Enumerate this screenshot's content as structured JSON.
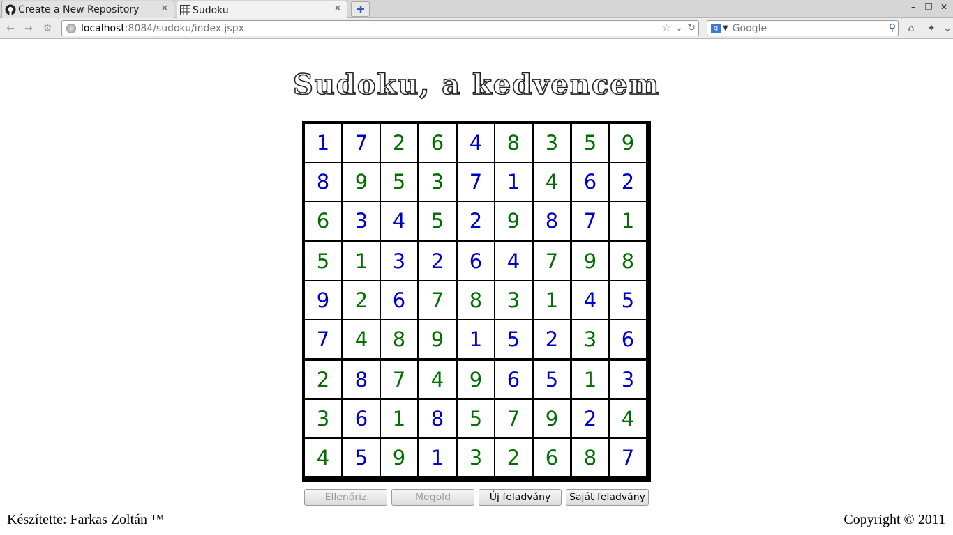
{
  "tabs": [
    {
      "title": "Create a New Repository",
      "icon": "github-icon"
    },
    {
      "title": "Sudoku",
      "icon": "grid-icon",
      "active": true
    }
  ],
  "nav": {
    "url_host": "localhost",
    "url_path": ":8084/sudoku/index.jspx",
    "search_placeholder": "Google"
  },
  "page": {
    "title": "Sudoku, a kedvencem",
    "footer_left": "Készítette: Farkas Zoltán ™",
    "footer_right": "Copyright © 2011"
  },
  "buttons": [
    {
      "label": "Ellenőriz",
      "enabled": false
    },
    {
      "label": "Megold",
      "enabled": false
    },
    {
      "label": "Új feladvány",
      "enabled": true
    },
    {
      "label": "Saját feladvány",
      "enabled": true
    }
  ],
  "colors": {
    "given": "#006e00",
    "user": "#0000cc"
  },
  "grid": [
    [
      1,
      7,
      2,
      6,
      4,
      8,
      3,
      5,
      9
    ],
    [
      8,
      9,
      5,
      3,
      7,
      1,
      4,
      6,
      2
    ],
    [
      6,
      3,
      4,
      5,
      2,
      9,
      8,
      7,
      1
    ],
    [
      5,
      1,
      3,
      2,
      6,
      4,
      7,
      9,
      8
    ],
    [
      9,
      2,
      6,
      7,
      8,
      3,
      1,
      4,
      5
    ],
    [
      7,
      4,
      8,
      9,
      1,
      5,
      2,
      3,
      6
    ],
    [
      2,
      8,
      7,
      4,
      9,
      6,
      5,
      1,
      3
    ],
    [
      3,
      6,
      1,
      8,
      5,
      7,
      9,
      2,
      4
    ],
    [
      4,
      5,
      9,
      1,
      3,
      2,
      6,
      8,
      7
    ]
  ],
  "given": [
    [
      0,
      0,
      1,
      1,
      0,
      1,
      1,
      1,
      1
    ],
    [
      0,
      1,
      1,
      1,
      0,
      0,
      1,
      0,
      0
    ],
    [
      1,
      0,
      0,
      1,
      0,
      1,
      0,
      0,
      1
    ],
    [
      1,
      1,
      0,
      0,
      0,
      0,
      1,
      1,
      1
    ],
    [
      0,
      1,
      0,
      1,
      1,
      1,
      1,
      0,
      0
    ],
    [
      0,
      1,
      1,
      1,
      0,
      0,
      0,
      1,
      0
    ],
    [
      1,
      0,
      1,
      1,
      1,
      0,
      0,
      1,
      0
    ],
    [
      1,
      0,
      1,
      0,
      1,
      1,
      1,
      0,
      1
    ],
    [
      1,
      0,
      1,
      0,
      1,
      1,
      1,
      1,
      0
    ]
  ]
}
